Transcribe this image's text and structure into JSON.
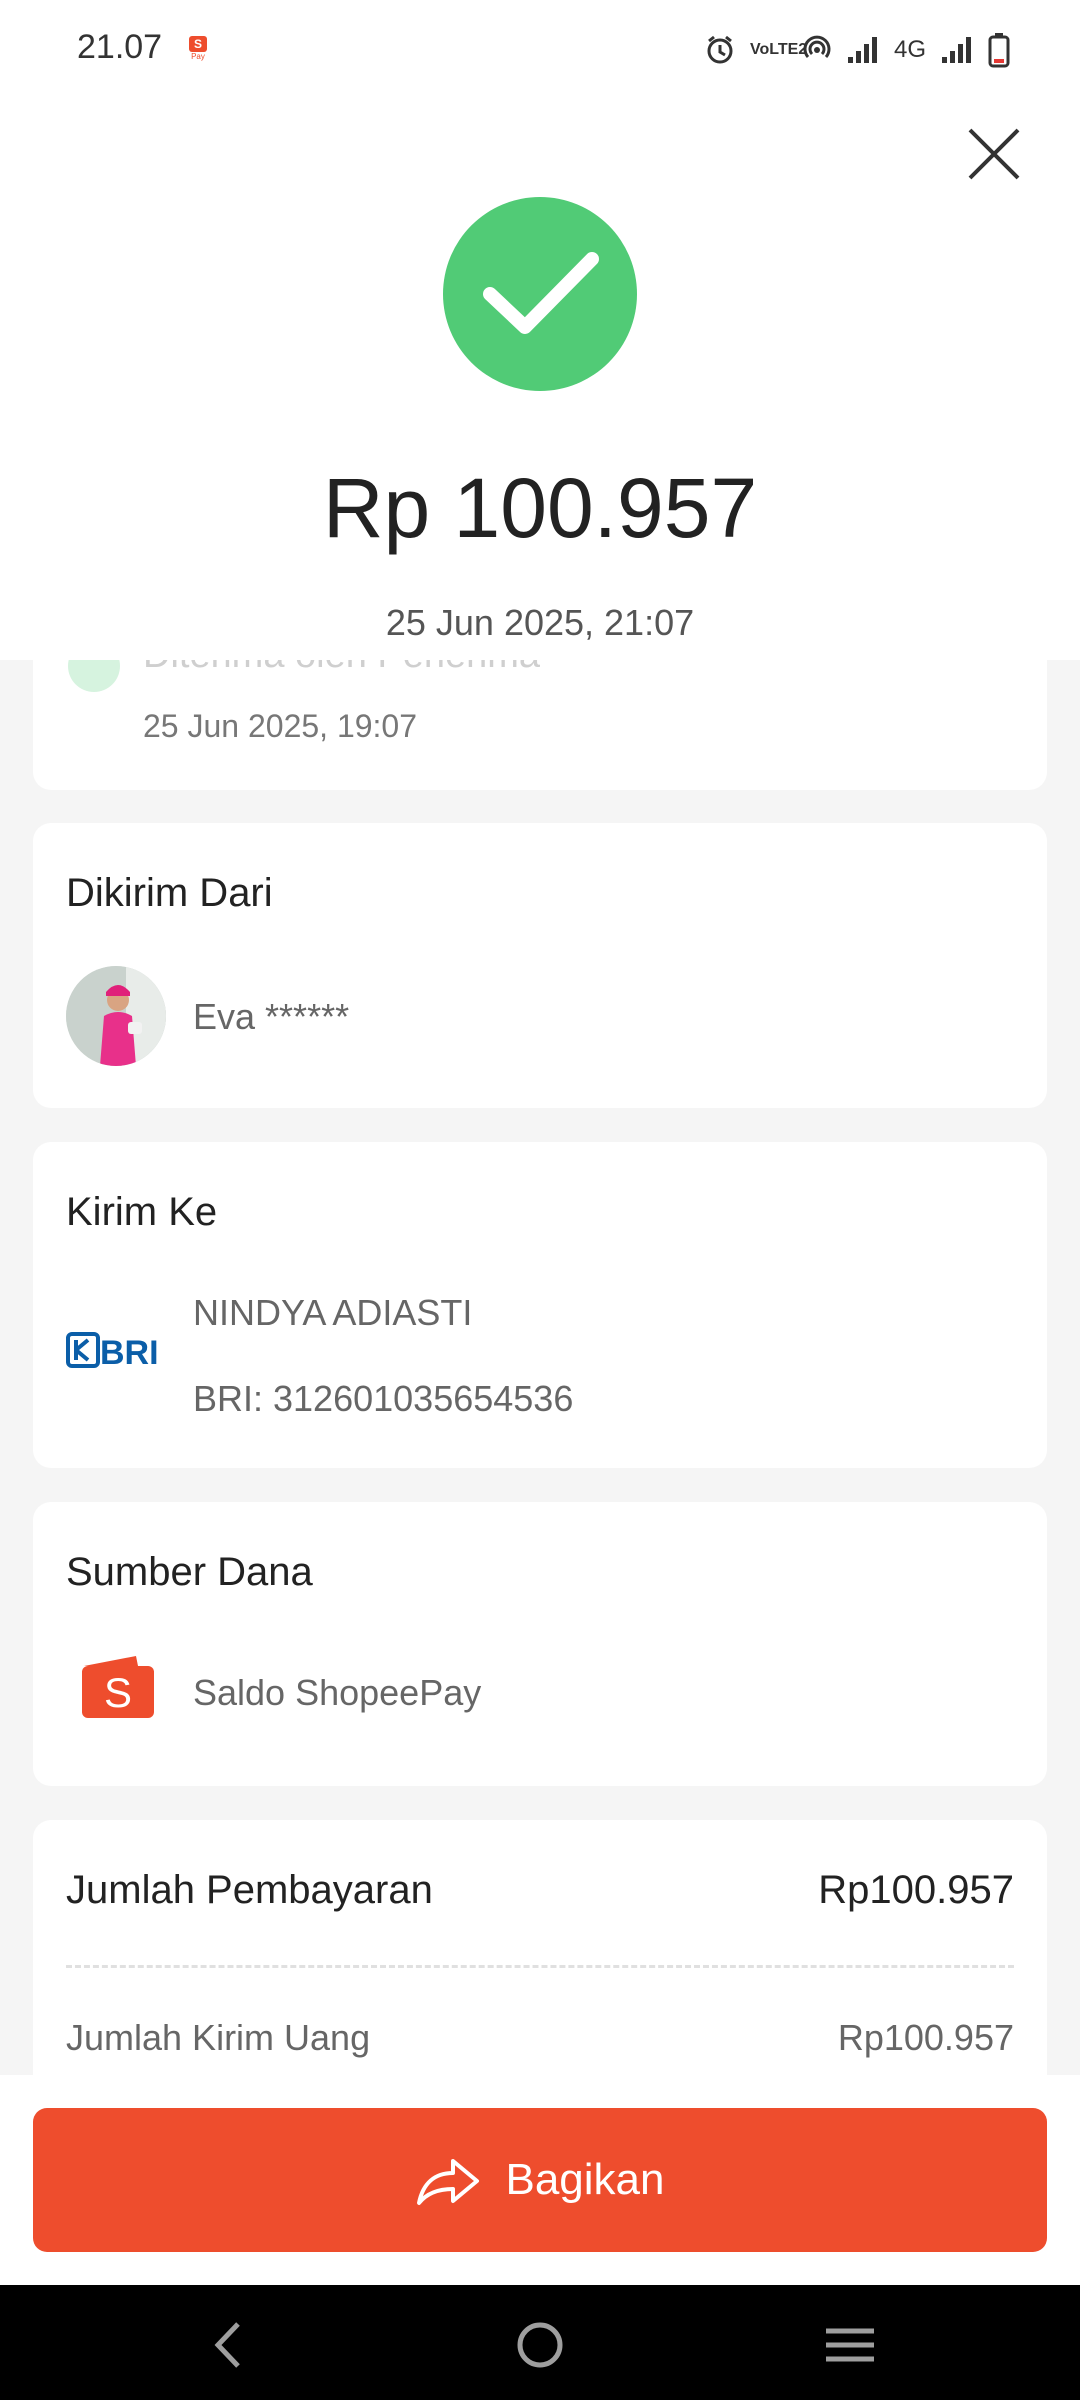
{
  "status_bar": {
    "time": "21.07",
    "notification_app": "ShopeePay",
    "notification_label": "Pay",
    "volte_label": "VoLTE2",
    "network_label": "4G",
    "icons": [
      "alarm-icon",
      "volte-icon",
      "hotspot-icon",
      "signal-icon",
      "network-4g-icon",
      "signal-icon",
      "battery-icon"
    ]
  },
  "header": {
    "close_icon": "close-icon",
    "success_icon": "check-icon",
    "amount": "Rp 100.957",
    "date": "25 Jun 2025, 21:07",
    "colors": {
      "success": "#51cb76"
    }
  },
  "timeline": {
    "status_text": "Diterima oleh Penerima",
    "date": "25 Jun 2025, 19:07"
  },
  "sender": {
    "title": "Dikirim Dari",
    "name": "Eva ******"
  },
  "recipient": {
    "title": "Kirim Ke",
    "bank_logo_text": "BRI",
    "name": "NINDYA ADIASTI",
    "account": "BRI: 312601035654536",
    "colors": {
      "bank": "#0b5ea8"
    }
  },
  "source": {
    "title": "Sumber Dana",
    "label": "Saldo ShopeePay",
    "logo_letter": "S"
  },
  "payment": {
    "total_label": "Jumlah Pembayaran",
    "total_value": "Rp100.957",
    "send_label": "Jumlah Kirim Uang",
    "send_value": "Rp100.957"
  },
  "actions": {
    "share_label": "Bagikan",
    "share_icon": "share-arrow-icon",
    "colors": {
      "primary": "#ee4d2d"
    }
  },
  "navbar": {
    "icons": [
      "back-icon",
      "home-icon",
      "menu-icon"
    ]
  }
}
